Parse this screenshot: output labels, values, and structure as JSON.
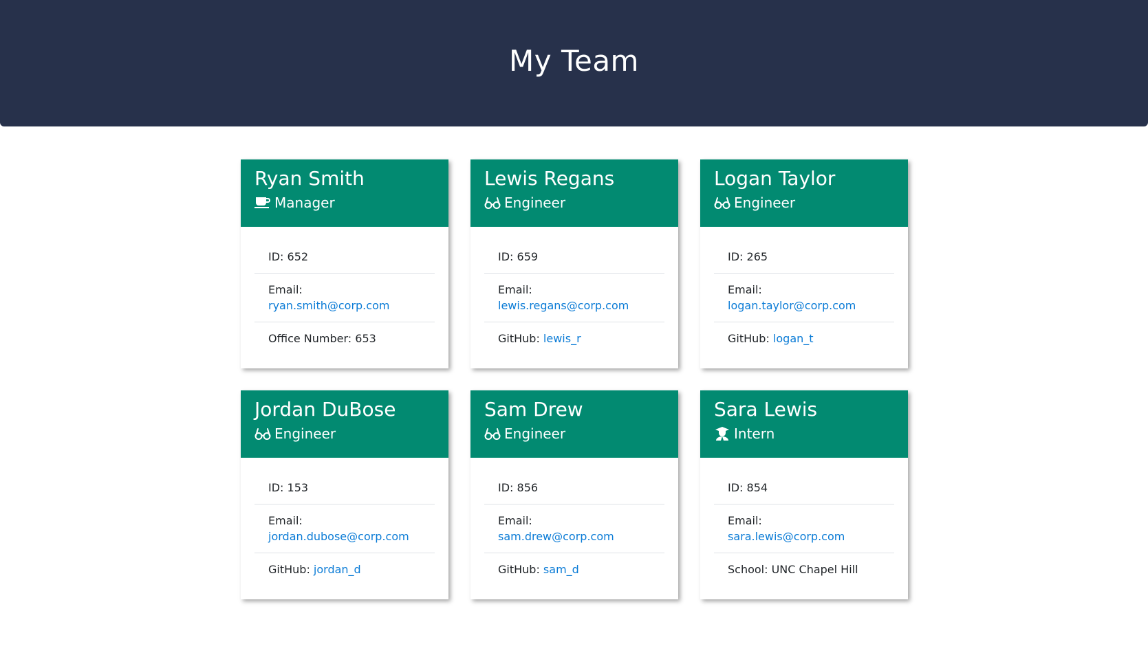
{
  "header": {
    "title": "My Team"
  },
  "team": [
    {
      "name": "Ryan Smith",
      "role": "Manager",
      "role_icon": "coffee-mug-icon",
      "id_label": "ID: 652",
      "email_label": "Email:",
      "email": "ryan.smith@corp.com",
      "extra_label": "Office Number: 653",
      "extra_value": ""
    },
    {
      "name": "Lewis Regans",
      "role": "Engineer",
      "role_icon": "glasses-icon",
      "id_label": "ID: 659",
      "email_label": "Email:",
      "email": "lewis.regans@corp.com",
      "extra_label": "GitHub: ",
      "extra_value": "lewis_r"
    },
    {
      "name": "Logan Taylor",
      "role": "Engineer",
      "role_icon": "glasses-icon",
      "id_label": "ID: 265",
      "email_label": "Email:",
      "email": "logan.taylor@corp.com",
      "extra_label": "GitHub: ",
      "extra_value": "logan_t"
    },
    {
      "name": "Jordan DuBose",
      "role": "Engineer",
      "role_icon": "glasses-icon",
      "id_label": "ID: 153",
      "email_label": "Email:",
      "email": "jordan.dubose@corp.com",
      "extra_label": "GitHub: ",
      "extra_value": "jordan_d"
    },
    {
      "name": "Sam Drew",
      "role": "Engineer",
      "role_icon": "glasses-icon",
      "id_label": "ID: 856",
      "email_label": "Email:",
      "email": "sam.drew@corp.com",
      "extra_label": "GitHub: ",
      "extra_value": "sam_d"
    },
    {
      "name": "Sara Lewis",
      "role": "Intern",
      "role_icon": "graduate-icon",
      "id_label": "ID: 854",
      "email_label": "Email:",
      "email": "sara.lewis@corp.com",
      "extra_label": "School: UNC Chapel Hill",
      "extra_value": ""
    }
  ],
  "colors": {
    "header_bg": "#27314b",
    "card_header_bg": "#028a71",
    "link": "#0a7bd6"
  }
}
